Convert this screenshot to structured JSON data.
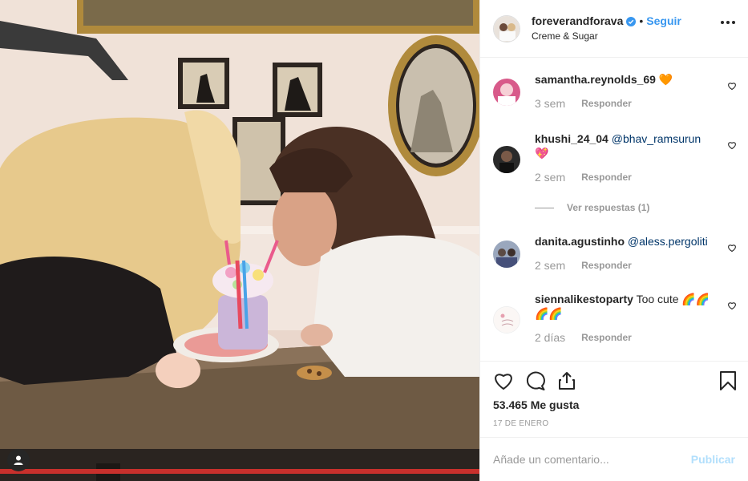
{
  "post": {
    "username": "foreverandforava",
    "follow_label": "Seguir",
    "separator": "•",
    "location": "Creme & Sugar",
    "verified_icon": "verified-badge-icon",
    "more_icon": "more-options-icon"
  },
  "comments": [
    {
      "user": "samantha.reynolds_69",
      "text": "🧡",
      "mention": "",
      "time": "3 sem",
      "reply_label": "Responder"
    },
    {
      "user": "khushi_24_04",
      "mention": "@bhav_ramsurun",
      "text": "💖",
      "time": "2 sem",
      "reply_label": "Responder"
    },
    {
      "user": "danita.agustinho",
      "mention": "@aless.pergoliti",
      "text": "",
      "time": "2 sem",
      "reply_label": "Responder"
    },
    {
      "user": "siennalikestoparty",
      "text": "Too cute 🌈🌈🌈🌈",
      "mention": "",
      "time": "2 días",
      "reply_label": "Responder"
    }
  ],
  "view_replies": "Ver respuestas (1)",
  "likes": "53.465 Me gusta",
  "date": "17 DE ENERO",
  "add_comment": {
    "placeholder": "Añade un comentario...",
    "publish_label": "Publicar"
  },
  "colors": {
    "accent": "#3897f0",
    "publish_disabled": "#b2dffc",
    "mention": "#003569",
    "secondary_text": "#999999"
  },
  "icons": [
    "heart-icon",
    "comment-icon",
    "share-icon",
    "bookmark-icon",
    "user-tag-icon"
  ]
}
